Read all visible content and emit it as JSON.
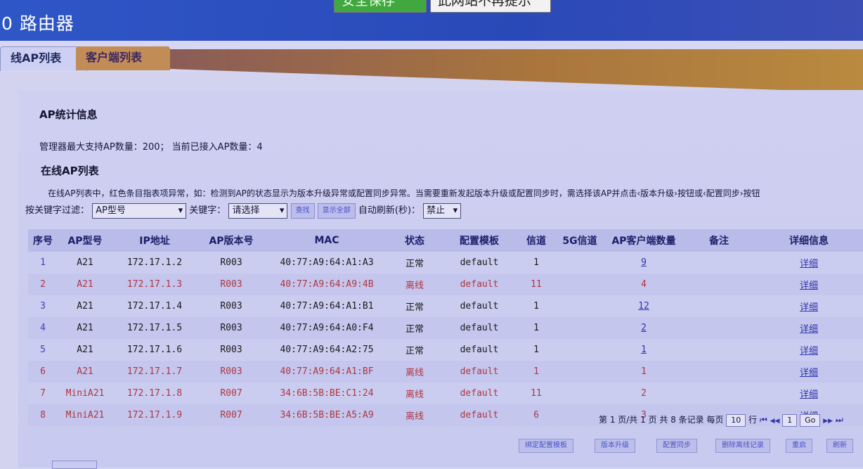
{
  "top_buttons": {
    "save": "安全保存",
    "no_more": "此网站不再提示"
  },
  "app_title": "0 路由器",
  "tabs": [
    "线AP列表",
    "客户端列表"
  ],
  "stats": {
    "title": "AP统计信息",
    "line": "管理器最大支持AP数量：200； 当前已接入AP数量：4"
  },
  "list": {
    "title": "在线AP列表",
    "note": "在线AP列表中，红色条目指表项异常，如：检测到AP的状态显示为版本升级异常或配置同步异常。当需要重新发起版本升级或配置同步时，需选择该AP并点击‹版本升级›按钮或‹配置同步›按钮"
  },
  "filter": {
    "label": "按关键字过滤：",
    "field": "AP型号",
    "keyword_label": "关键字：",
    "keyword_value": "请选择",
    "search_btn": "查找",
    "show_all_btn": "显示全部",
    "refresh_label": "自动刷新(秒)：",
    "refresh_value": "禁止"
  },
  "table": {
    "headers": [
      "序号",
      "AP型号",
      "IP地址",
      "AP版本号",
      "MAC",
      "状态",
      "配置模板",
      "信道",
      "5G信道",
      "AP客户端数量",
      "备注",
      "详细信息"
    ],
    "rows": [
      {
        "idx": "1",
        "model": "A21",
        "ip": "172.17.1.2",
        "ver": "R003",
        "mac": "40:77:A9:64:A1:A3",
        "status": "正常",
        "tpl": "default",
        "ch": "1",
        "ch5": "",
        "clients": "9",
        "note": "",
        "detail": "详细",
        "offline": false
      },
      {
        "idx": "2",
        "model": "A21",
        "ip": "172.17.1.3",
        "ver": "R003",
        "mac": "40:77:A9:64:A9:4B",
        "status": "离线",
        "tpl": "default",
        "ch": "11",
        "ch5": "",
        "clients": "4",
        "note": "",
        "detail": "详细",
        "offline": true
      },
      {
        "idx": "3",
        "model": "A21",
        "ip": "172.17.1.4",
        "ver": "R003",
        "mac": "40:77:A9:64:A1:B1",
        "status": "正常",
        "tpl": "default",
        "ch": "1",
        "ch5": "",
        "clients": "12",
        "note": "",
        "detail": "详细",
        "offline": false
      },
      {
        "idx": "4",
        "model": "A21",
        "ip": "172.17.1.5",
        "ver": "R003",
        "mac": "40:77:A9:64:A0:F4",
        "status": "正常",
        "tpl": "default",
        "ch": "1",
        "ch5": "",
        "clients": "2",
        "note": "",
        "detail": "详细",
        "offline": false
      },
      {
        "idx": "5",
        "model": "A21",
        "ip": "172.17.1.6",
        "ver": "R003",
        "mac": "40:77:A9:64:A2:75",
        "status": "正常",
        "tpl": "default",
        "ch": "1",
        "ch5": "",
        "clients": "1",
        "note": "",
        "detail": "详细",
        "offline": false
      },
      {
        "idx": "6",
        "model": "A21",
        "ip": "172.17.1.7",
        "ver": "R003",
        "mac": "40:77:A9:64:A1:BF",
        "status": "离线",
        "tpl": "default",
        "ch": "1",
        "ch5": "",
        "clients": "1",
        "note": "",
        "detail": "详细",
        "offline": true
      },
      {
        "idx": "7",
        "model": "MiniA21",
        "ip": "172.17.1.8",
        "ver": "R007",
        "mac": "34:6B:5B:BE:C1:24",
        "status": "离线",
        "tpl": "default",
        "ch": "11",
        "ch5": "",
        "clients": "2",
        "note": "",
        "detail": "详细",
        "offline": true
      },
      {
        "idx": "8",
        "model": "MiniA21",
        "ip": "172.17.1.9",
        "ver": "R007",
        "mac": "34:6B:5B:BE:A5:A9",
        "status": "离线",
        "tpl": "default",
        "ch": "6",
        "ch5": "",
        "clients": "3",
        "note": "",
        "detail": "详细",
        "offline": true
      }
    ]
  },
  "pager": {
    "summary": "第 1 页/共 1 页 共 8 条记录 每页",
    "per_page": "10",
    "rows_label": "行",
    "first": "⏮",
    "prev": "◀◀",
    "page": "1",
    "go": "Go",
    "next": "▶▶",
    "last": "⏭"
  },
  "actions": [
    "绑定配置模板",
    "版本升级",
    "配置同步",
    "删除离线记录",
    "重启",
    "刷新"
  ]
}
